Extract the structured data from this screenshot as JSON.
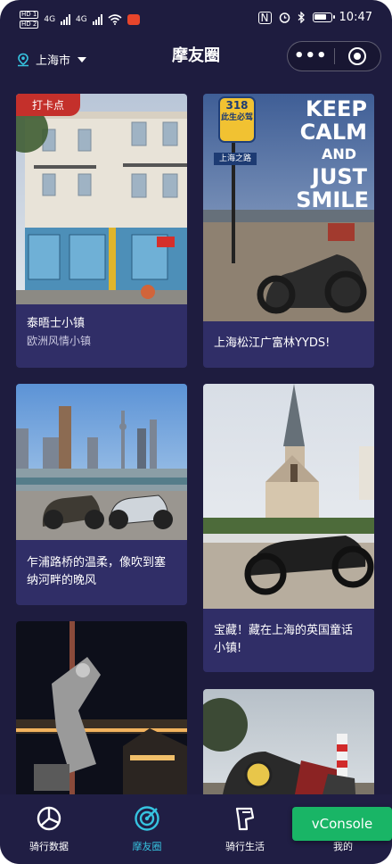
{
  "status_bar": {
    "sim1": "HD 1",
    "sim2": "HD 2",
    "net1": "4G",
    "net2": "4G",
    "time": "10:47"
  },
  "nav": {
    "city": "上海市",
    "title": "摩友圈",
    "more": "•••"
  },
  "cards": [
    {
      "tag": "打卡点",
      "title": "泰晤士小镇",
      "subtitle": "欧洲风情小镇"
    },
    {
      "title": "上海松江广富林YYDS!"
    },
    {
      "title": "乍浦路桥的温柔，像吹到塞纳河畔的晚风"
    },
    {
      "title": "宝藏！藏在上海的英国童话小镇!"
    }
  ],
  "photo_text": {
    "sign_top": "318",
    "sign_cn": "此生必驾",
    "sign_board": "上海之路",
    "keep": "KEEP",
    "calm": "CALM",
    "and": "AND",
    "just": "JUST",
    "smile": "SMILE"
  },
  "tabbar": {
    "tabs": [
      {
        "label": "骑行数据",
        "icon": "pie-chart-icon"
      },
      {
        "label": "摩友圈",
        "icon": "target-icon",
        "active": true
      },
      {
        "label": "骑行生活",
        "icon": "helmet-icon"
      },
      {
        "label": "我的",
        "icon": "user-icon"
      }
    ],
    "vconsole": "vConsole"
  },
  "colors": {
    "background": "#1e1c3f",
    "card": "#302e67",
    "active_tab": "#36c3e0",
    "tag": "#c4302b",
    "vconsole": "#19b566"
  }
}
